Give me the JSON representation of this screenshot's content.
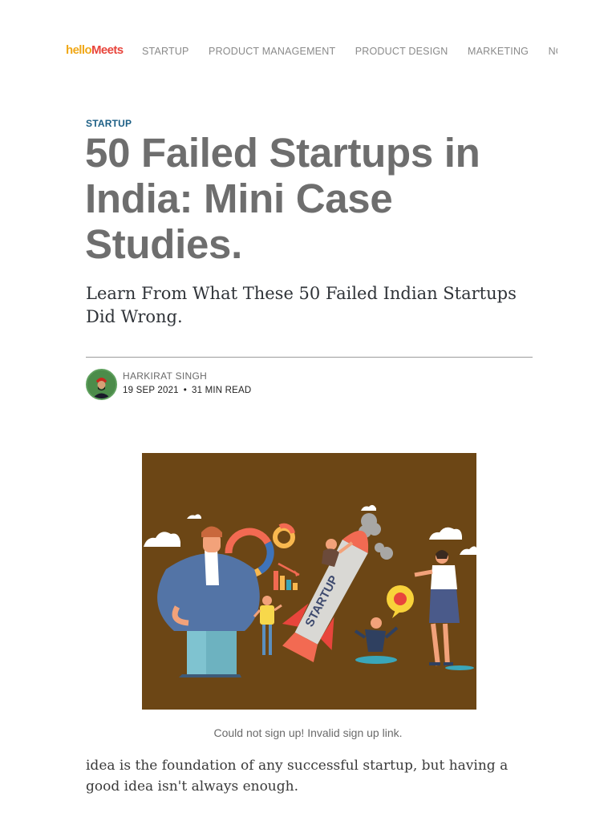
{
  "header": {
    "logo_hello": "hello",
    "logo_meets": "Meets",
    "nav": [
      "STARTUP",
      "PRODUCT MANAGEMENT",
      "PRODUCT DESIGN",
      "MARKETING",
      "NO COD"
    ]
  },
  "article": {
    "category": "STARTUP",
    "title": "50 Failed Startups in India: Mini Case Studies.",
    "subtitle": "Learn From What These 50 Failed Indian Startups Did Wrong.",
    "author": "HARKIRAT SINGH",
    "date": "19 SEP 2021",
    "separator": "•",
    "read_time": "31 MIN READ",
    "image_text": "STARTUP",
    "caption": "Could not sign up! Invalid sign up link.",
    "body": "idea is the foundation of any successful startup, but having a good idea isn't always enough."
  },
  "colors": {
    "accent": "#1c5f85",
    "logo_hello": "#f0a818",
    "logo_meets": "#e8453c",
    "image_bg": "#6c4615"
  }
}
